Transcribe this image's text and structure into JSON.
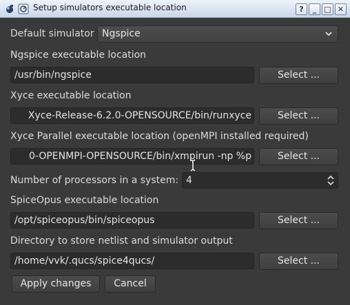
{
  "window": {
    "title": "Setup simulators executable location",
    "help_label": "?",
    "minimize_label": "_",
    "maximize_label": "□",
    "close_label": "✕"
  },
  "default_simulator": {
    "label": "Default simulator",
    "value": "Ngspice"
  },
  "ngspice": {
    "label": "Ngspice executable location",
    "value": "/usr/bin/ngspice",
    "button": "Select ..."
  },
  "xyce": {
    "label": "Xyce executable location",
    "value": "Xyce-Release-6.2.0-OPENSOURCE/bin/runxyce",
    "button": "Select ..."
  },
  "xyce_parallel": {
    "label": "Xyce Parallel executable location (openMPI installed required)",
    "value": "0-OPENMPI-OPENSOURCE/bin/xmpirun -np %p",
    "button": "Select ..."
  },
  "processors": {
    "label": "Number of processors in a system:",
    "value": "4"
  },
  "spiceopus": {
    "label": "SpiceOpus executable location",
    "value": "/opt/spiceopus/bin/spiceopus",
    "button": "Select ..."
  },
  "netlist_dir": {
    "label": "Directory to store netlist and simulator output",
    "value": "/home/vvk/.qucs/spice4qucs/",
    "button": "Select ..."
  },
  "actions": {
    "apply": "Apply changes",
    "cancel": "Cancel"
  },
  "icons": {
    "app": "app-menu-icon",
    "pin": "pin-icon",
    "cursor": "text-cursor-icon"
  }
}
